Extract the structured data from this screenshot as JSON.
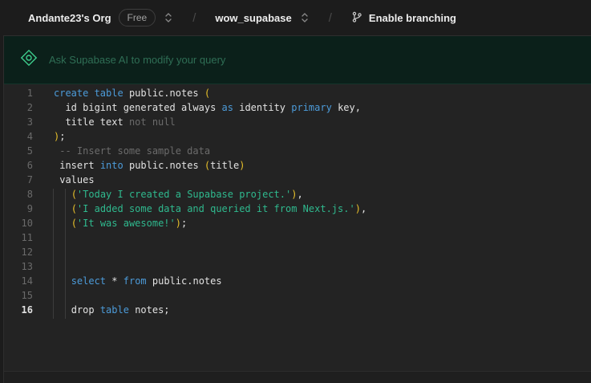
{
  "topbar": {
    "org_name": "Andante23's Org",
    "plan_badge": "Free",
    "separator": "/",
    "project_name": "wow_supabase",
    "branching_label": "Enable branching"
  },
  "ai_bar": {
    "placeholder": "Ask Supabase AI to modify your query"
  },
  "editor": {
    "active_line": 16,
    "lines": [
      {
        "n": "1"
      },
      {
        "n": "2"
      },
      {
        "n": "3"
      },
      {
        "n": "4"
      },
      {
        "n": "5"
      },
      {
        "n": "6"
      },
      {
        "n": "7"
      },
      {
        "n": "8"
      },
      {
        "n": "9"
      },
      {
        "n": "10"
      },
      {
        "n": "11"
      },
      {
        "n": "12"
      },
      {
        "n": "13"
      },
      {
        "n": "14"
      },
      {
        "n": "15"
      },
      {
        "n": "16"
      }
    ],
    "tokens": {
      "create_table": "create table",
      "public_notes": "public.notes",
      "open_paren": "(",
      "close_paren": ")",
      "close_paren_semi": ")",
      "semicolon": ";",
      "id_col": "id bigint generated always",
      "as": "as",
      "identity": "identity",
      "primary": "primary",
      "key": "key,",
      "title_col": "title text",
      "not_null": "not null",
      "comment": "-- Insert some sample data",
      "insert": "insert",
      "into": "into",
      "title_ident": "title",
      "values_kw": "values",
      "str1": "'Today I created a Supabase project.'",
      "str2": "'I added some data and queried it from Next.js.'",
      "str3": "'It was awesome!'",
      "comma": ",",
      "select": "select",
      "star": "*",
      "from": "from",
      "drop": "drop",
      "table": "table",
      "notes_semi": "notes;"
    }
  },
  "colors": {
    "keyword": "#4c9bd9",
    "string": "#2fb98e",
    "bracket": "#e8c02a",
    "comment": "#6b6b6b",
    "ai_bar_bg": "#0b201a",
    "brand_green": "#3ecf8e"
  },
  "icons": {
    "chevron": "chevron-up-down-icon",
    "branch": "git-branch-icon",
    "ai": "supabase-ai-icon"
  }
}
